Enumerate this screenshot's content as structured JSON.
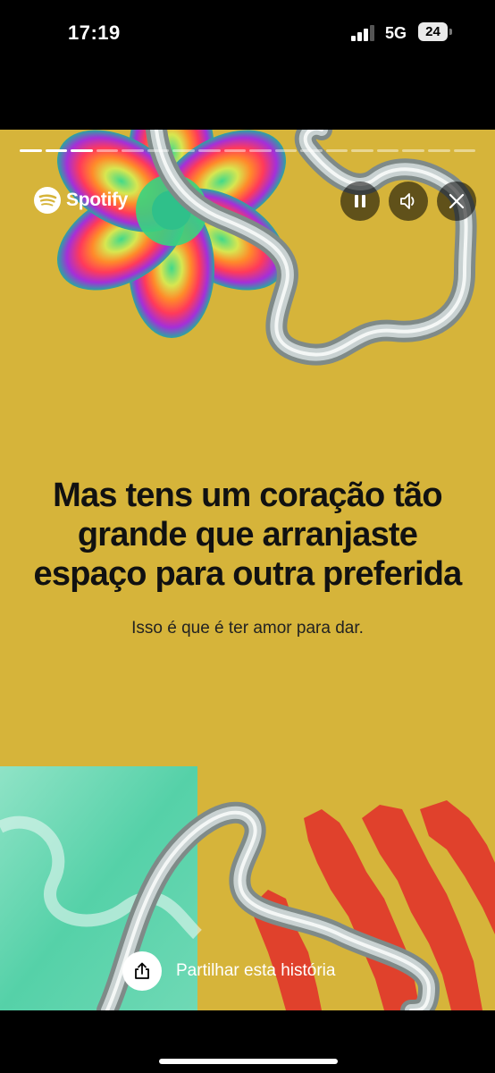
{
  "status_bar": {
    "time": "17:19",
    "network": "5G",
    "battery": "24"
  },
  "story": {
    "background_color": "#d6b43a",
    "progress_total": 18,
    "progress_done": 3,
    "brand": "Spotify",
    "headline": [
      "Mas tens um coração tão",
      "grande que arranjaste",
      "espaço para outra preferida"
    ],
    "subtext": "Isso é que é ter amor para dar.",
    "share_label": "Partilhar esta história"
  },
  "icons": {
    "logo": "spotify-logo-icon",
    "pause": "pause-icon",
    "sound": "speaker-icon",
    "close": "close-icon",
    "share": "share-icon"
  }
}
